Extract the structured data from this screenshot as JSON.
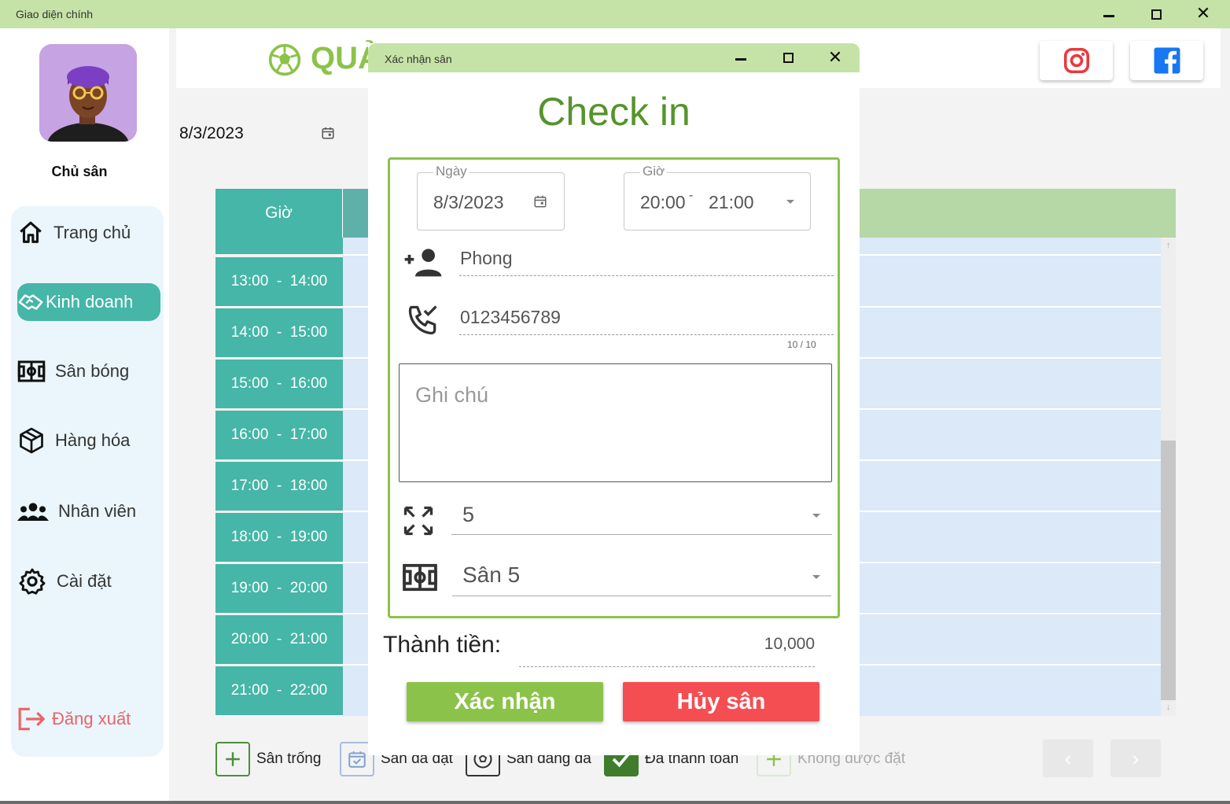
{
  "window": {
    "title": "Giao diện chính"
  },
  "sidebar": {
    "owner": "Chủ sân",
    "items": [
      {
        "label": "Trang chủ",
        "icon": "home-icon"
      },
      {
        "label": "Kinh doanh",
        "icon": "handshake-icon",
        "active": true
      },
      {
        "label": "Sân bóng",
        "icon": "stadium-icon"
      },
      {
        "label": "Hàng hóa",
        "icon": "box-icon"
      },
      {
        "label": "Nhân viên",
        "icon": "people-icon"
      },
      {
        "label": "Cài đặt",
        "icon": "gear-icon"
      }
    ],
    "logout": "Đăng xuất"
  },
  "header": {
    "brand_partial": "QUẢ"
  },
  "main": {
    "date": "8/3/2023",
    "schedule": {
      "time_header": "Giờ",
      "slots": [
        "13:00  -  14:00",
        "14:00  -  15:00",
        "15:00  -  16:00",
        "16:00  -  17:00",
        "17:00  -  18:00",
        "18:00  -  19:00",
        "19:00  -  20:00",
        "20:00  -  21:00",
        "21:00  -  22:00"
      ]
    },
    "legend": [
      {
        "label": "Sân trống"
      },
      {
        "label": "Sân đã đặt"
      },
      {
        "label": "Sân đang đá"
      },
      {
        "label": "Đã thanh toán"
      },
      {
        "label": "Không được đặt"
      }
    ]
  },
  "dialog": {
    "title": "Xác nhận sân",
    "heading": "Check in",
    "date_legend": "Ngày",
    "date_value": "8/3/2023",
    "time_legend": "Giờ",
    "time_from": "20:00",
    "time_sep": "-",
    "time_to": "21:00",
    "customer_name": "Phong",
    "phone": "0123456789",
    "phone_counter": "10 / 10",
    "note_placeholder": "Ghi chú",
    "field_size": "5",
    "field_name": "Sân 5",
    "total_label": "Thành tiền:",
    "total_value": "10,000",
    "confirm_label": "Xác nhận",
    "cancel_label": "Hủy sân"
  },
  "colors": {
    "accent_green": "#8bc34a",
    "teal": "#45b6a8",
    "danger": "#f44e53",
    "titlebar": "#c5e3a6",
    "grid": "#dbe9f9"
  }
}
